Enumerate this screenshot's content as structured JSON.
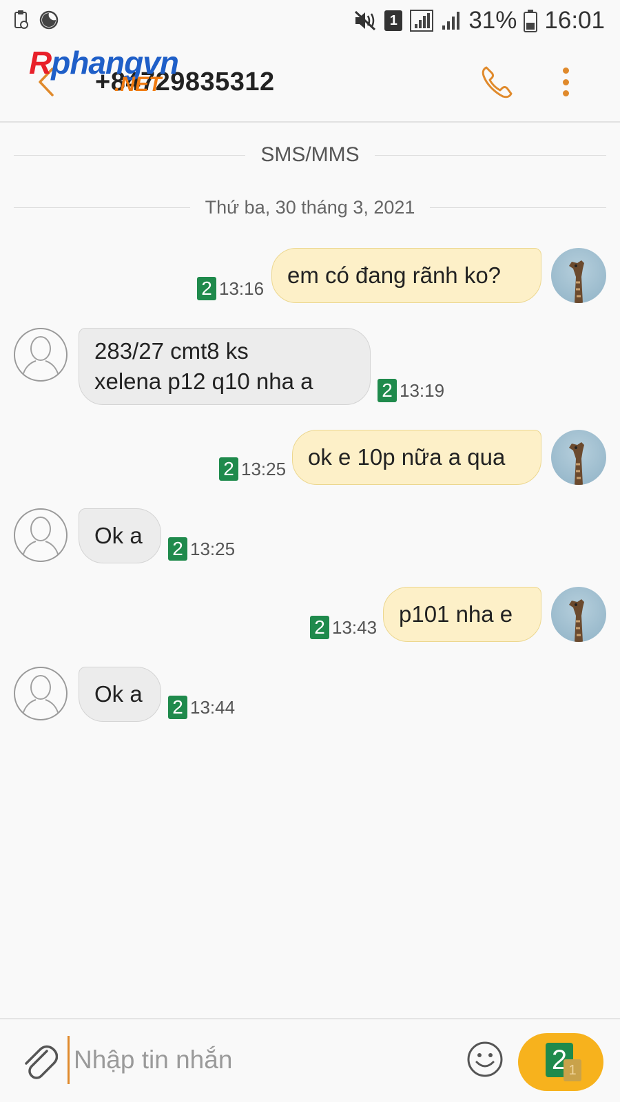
{
  "status_bar": {
    "battery_percent": "31%",
    "time": "16:01",
    "sim_slot": "1"
  },
  "header": {
    "watermark_main": "Rphangvn",
    "watermark_main_red": "R",
    "watermark_main_blue": "phangvn",
    "watermark_sub": ".NET",
    "contact": "+84729835312"
  },
  "thread": {
    "channel_label": "SMS/MMS",
    "date_label": "Thứ ba, 30 tháng 3, 2021"
  },
  "messages": [
    {
      "direction": "out",
      "line1": "em có đang rãnh ko?",
      "line2": "",
      "sim": "2",
      "time": "13:16"
    },
    {
      "direction": "in",
      "line1": "283/27 cmt8 ks",
      "line2": "xelena p12 q10 nha a",
      "sim": "2",
      "time": "13:19"
    },
    {
      "direction": "out",
      "line1": "ok e 10p nữa a qua",
      "line2": "",
      "sim": "2",
      "time": "13:25"
    },
    {
      "direction": "in",
      "line1": "Ok a",
      "line2": "",
      "sim": "2",
      "time": "13:25"
    },
    {
      "direction": "out",
      "line1": "p101 nha e",
      "line2": "",
      "sim": "2",
      "time": "13:43"
    },
    {
      "direction": "in",
      "line1": "Ok a",
      "line2": "",
      "sim": "2",
      "time": "13:44"
    }
  ],
  "composer": {
    "placeholder": "Nhập tin nhắn",
    "send_sim": "2",
    "send_sim_secondary": "1"
  },
  "colors": {
    "accent": "#e08a2c",
    "outgoing_bubble": "#fdf0c8",
    "incoming_bubble": "#ececec",
    "sim_badge": "#1f8a4c",
    "send_button": "#f7b21d"
  },
  "icons": [
    "back-arrow-icon",
    "phone-icon",
    "more-vert-icon",
    "attach-icon",
    "emoji-icon",
    "giraffe-avatar-icon",
    "person-avatar-icon",
    "mute-icon",
    "signal-icon",
    "battery-icon",
    "moon-icon",
    "clipboard-icon"
  ]
}
